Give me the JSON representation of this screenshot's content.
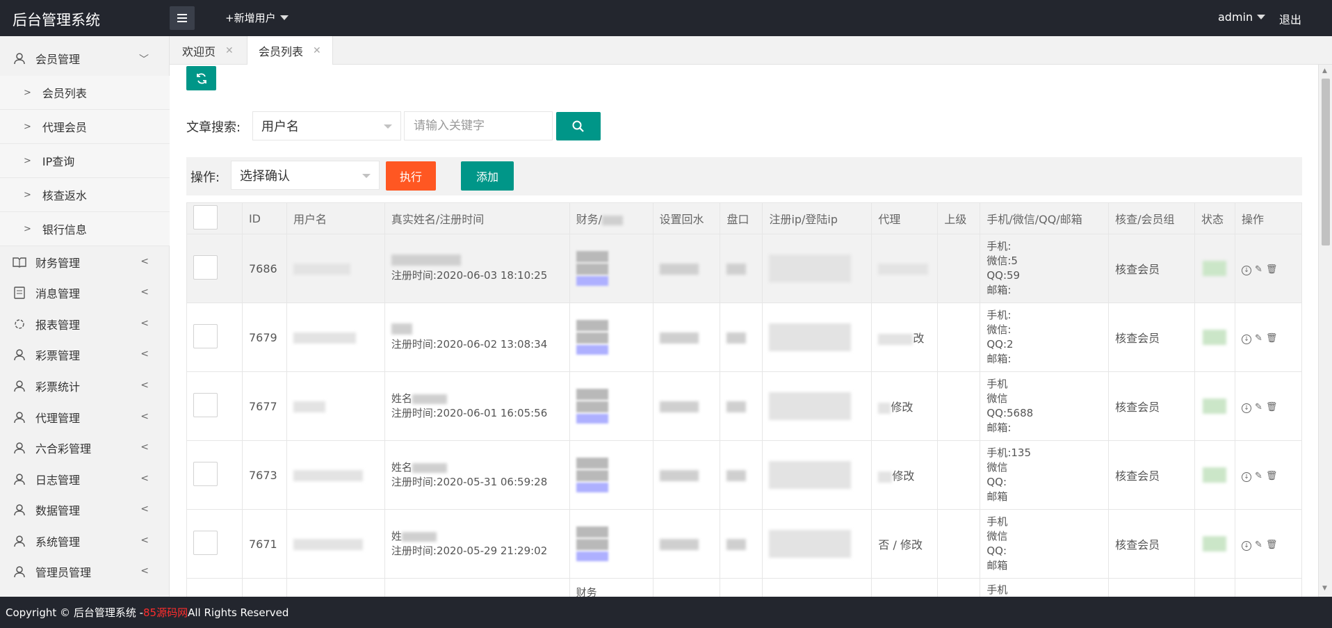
{
  "header": {
    "title": "后台管理系统",
    "add_user": "+新增用户",
    "user": "admin",
    "logout": "退出"
  },
  "sidebar": {
    "groups": [
      {
        "label": "会员管理",
        "icon": "user-icon",
        "expanded": true
      },
      {
        "label": "财务管理",
        "icon": "book-icon"
      },
      {
        "label": "消息管理",
        "icon": "message-icon"
      },
      {
        "label": "报表管理",
        "icon": "report-icon"
      },
      {
        "label": "彩票管理",
        "icon": "user-icon"
      },
      {
        "label": "彩票统计",
        "icon": "user-icon"
      },
      {
        "label": "代理管理",
        "icon": "user-icon"
      },
      {
        "label": "六合彩管理",
        "icon": "user-icon"
      },
      {
        "label": "日志管理",
        "icon": "user-icon"
      },
      {
        "label": "数据管理",
        "icon": "user-icon"
      },
      {
        "label": "系统管理",
        "icon": "user-icon"
      },
      {
        "label": "管理员管理",
        "icon": "user-icon"
      }
    ],
    "member_sub": [
      "会员列表",
      "代理会员",
      "IP查询",
      "核查返水",
      "银行信息"
    ]
  },
  "tabs": [
    {
      "label": "欢迎页"
    },
    {
      "label": "会员列表",
      "active": true
    }
  ],
  "search": {
    "label": "文章搜索:",
    "field_selected": "用户名",
    "placeholder": "请输入关键字"
  },
  "operation": {
    "label": "操作:",
    "selected": "选择确认",
    "exec_label": "执行",
    "add_label": "添加"
  },
  "table": {
    "headers": [
      "",
      "ID",
      "用户名",
      "真实姓名/注册时间",
      "财务/",
      "设置回水",
      "盘口",
      "注册ip/登陆ip",
      "代理",
      "上级",
      "手机/微信/QQ/邮箱",
      "核查/会员组",
      "状态",
      "操作"
    ],
    "rows": [
      {
        "id": "7686",
        "name_prefix": "",
        "reg": "注册时间:2020-06-03 18:10:25",
        "fin": [
          "查",
          "修",
          "0"
        ],
        "agent": "",
        "contact": [
          "手机:",
          "微信:5",
          "QQ:59",
          "邮箱:"
        ],
        "group": "核查会员"
      },
      {
        "id": "7679",
        "name_prefix": "",
        "reg": "注册时间:2020-06-02 13:08:34",
        "fin": [
          "查",
          "修",
          "0"
        ],
        "agent": "改",
        "contact": [
          "手机:",
          "微信:",
          "QQ:2",
          "邮箱:"
        ],
        "group": "核查会员"
      },
      {
        "id": "7677",
        "name_prefix": "姓名",
        "reg": "注册时间:2020-06-01 16:05:56",
        "fin": [
          "",
          "",
          ""
        ],
        "agent": "修改",
        "contact": [
          "手机",
          "微信",
          "QQ:5688",
          "邮箱:"
        ],
        "group": "核查会员"
      },
      {
        "id": "7673",
        "name_prefix": "姓名",
        "reg": "注册时间:2020-05-31 06:59:28",
        "fin": [
          "",
          "",
          ""
        ],
        "agent": "修改",
        "contact": [
          "手机:135",
          "微信",
          "QQ:",
          "邮箱"
        ],
        "group": "核查会员"
      },
      {
        "id": "7671",
        "name_prefix": "姓",
        "reg": "注册时间:2020-05-29 21:29:02",
        "fin": [
          "",
          "",
          ""
        ],
        "agent": "否 / 修改",
        "contact": [
          "手机",
          "微信",
          "QQ:",
          "邮箱"
        ],
        "group": "核查会员"
      },
      {
        "id": "",
        "name_prefix": "",
        "reg": "",
        "fin": [
          "财务",
          "",
          ""
        ],
        "agent": "",
        "contact": [
          "手机",
          "",
          "",
          ""
        ],
        "group": ""
      }
    ]
  },
  "footer": {
    "prefix": "Copyright © 后台管理系统 - ",
    "site": "85源码网",
    "suffix": " All Rights Reserved"
  }
}
